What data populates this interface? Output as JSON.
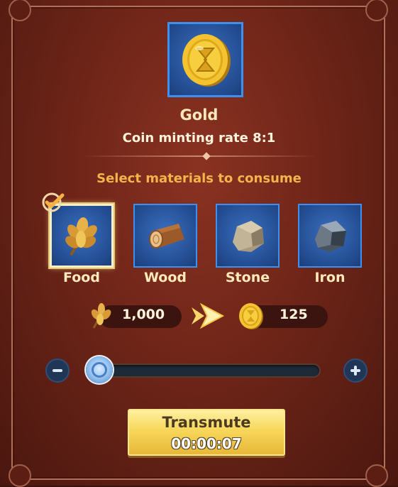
{
  "target": {
    "name": "Gold",
    "rate_text": "Coin minting rate 8:1",
    "icon": "gold-coin-icon"
  },
  "prompt": "Select materials to consume",
  "materials": [
    {
      "label": "Food",
      "icon": "wheat-icon",
      "selected": true
    },
    {
      "label": "Wood",
      "icon": "log-icon",
      "selected": false
    },
    {
      "label": "Stone",
      "icon": "stone-icon",
      "selected": false
    },
    {
      "label": "Iron",
      "icon": "iron-ore-icon",
      "selected": false
    }
  ],
  "conversion": {
    "input_amount": "1,000",
    "input_icon": "wheat-icon",
    "output_amount": "125",
    "output_icon": "gold-coin-icon"
  },
  "slider": {
    "value_fraction": 0.0
  },
  "action": {
    "label": "Transmute",
    "timer": "00:00:07"
  },
  "colors": {
    "accent_blue": "#3d8ff0",
    "prompt_orange": "#f3b44b",
    "button_gold": "#f7d75a"
  }
}
